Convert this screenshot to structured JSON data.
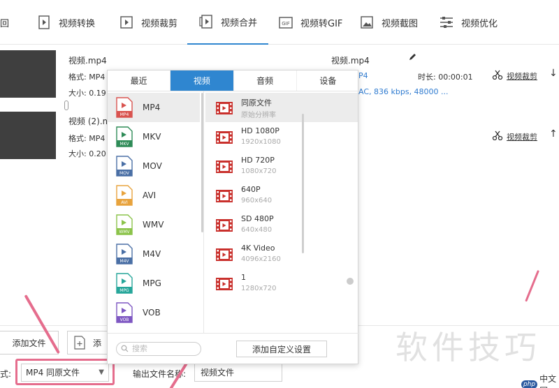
{
  "toolbar": {
    "items": [
      {
        "label": "回",
        "icon": "back-icon"
      },
      {
        "label": "视频转换",
        "icon": "convert-icon"
      },
      {
        "label": "视频裁剪",
        "icon": "crop-icon"
      },
      {
        "label": "视频合并",
        "icon": "merge-icon",
        "active": true
      },
      {
        "label": "视频转GIF",
        "icon": "gif-icon"
      },
      {
        "label": "视频截图",
        "icon": "screenshot-icon"
      },
      {
        "label": "视频优化",
        "icon": "optimize-icon"
      }
    ]
  },
  "files": [
    {
      "name": "视频.mp4",
      "format": "格式: MP4",
      "size": "大小: 0.19",
      "out_name": "视频.mp4",
      "out_format": "P4",
      "duration": "时长: 00:00:01",
      "codec": "AC, 836 kbps, 48000 ...",
      "cut_label": "视频裁剪"
    },
    {
      "name": "视频 (2).m",
      "format": "格式: MP4",
      "size": "大小: 0.20",
      "cut_label": "视频裁剪"
    }
  ],
  "popup": {
    "tabs": [
      {
        "label": "最近"
      },
      {
        "label": "视频",
        "active": true
      },
      {
        "label": "音频"
      },
      {
        "label": "设备"
      }
    ],
    "formats": [
      {
        "name": "MP4",
        "tag": "MP4",
        "color": "#d9534f",
        "selected": true
      },
      {
        "name": "MKV",
        "tag": "MKV",
        "color": "#2e8b57"
      },
      {
        "name": "MOV",
        "tag": "MOV",
        "color": "#4a6fa5"
      },
      {
        "name": "AVI",
        "tag": "AVI",
        "color": "#e8a33d"
      },
      {
        "name": "WMV",
        "tag": "WMV",
        "color": "#8bc34a"
      },
      {
        "name": "M4V",
        "tag": "M4V",
        "color": "#4a6fa5"
      },
      {
        "name": "MPG",
        "tag": "MPG",
        "color": "#26a69a"
      },
      {
        "name": "VOB",
        "tag": "VOB",
        "color": "#7e57c2"
      }
    ],
    "resolutions": [
      {
        "name": "同原文件",
        "sub": "原始分辨率",
        "selected": true
      },
      {
        "name": "HD 1080P",
        "sub": "1920x1080"
      },
      {
        "name": "HD 720P",
        "sub": "1080x720"
      },
      {
        "name": "640P",
        "sub": "960x640"
      },
      {
        "name": "SD 480P",
        "sub": "640x480"
      },
      {
        "name": "4K Video",
        "sub": "4096x2160"
      },
      {
        "name": "1",
        "sub": "1280x720"
      }
    ],
    "search_placeholder": "搜索",
    "custom_label": "添加自定义设置"
  },
  "bottom": {
    "add_file_label": "添加文件",
    "add_folder_label": "添",
    "format_prefix": "式:",
    "format_value": "MP4 同原文件",
    "output_name_label": "输出文件名称:",
    "output_name_value": "视频文件"
  },
  "watermark": {
    "text": "软件技巧",
    "logo_text": "php",
    "site_text": "中文网"
  },
  "colors": {
    "accent": "#2f86d0",
    "annotation": "#e56d8d"
  }
}
